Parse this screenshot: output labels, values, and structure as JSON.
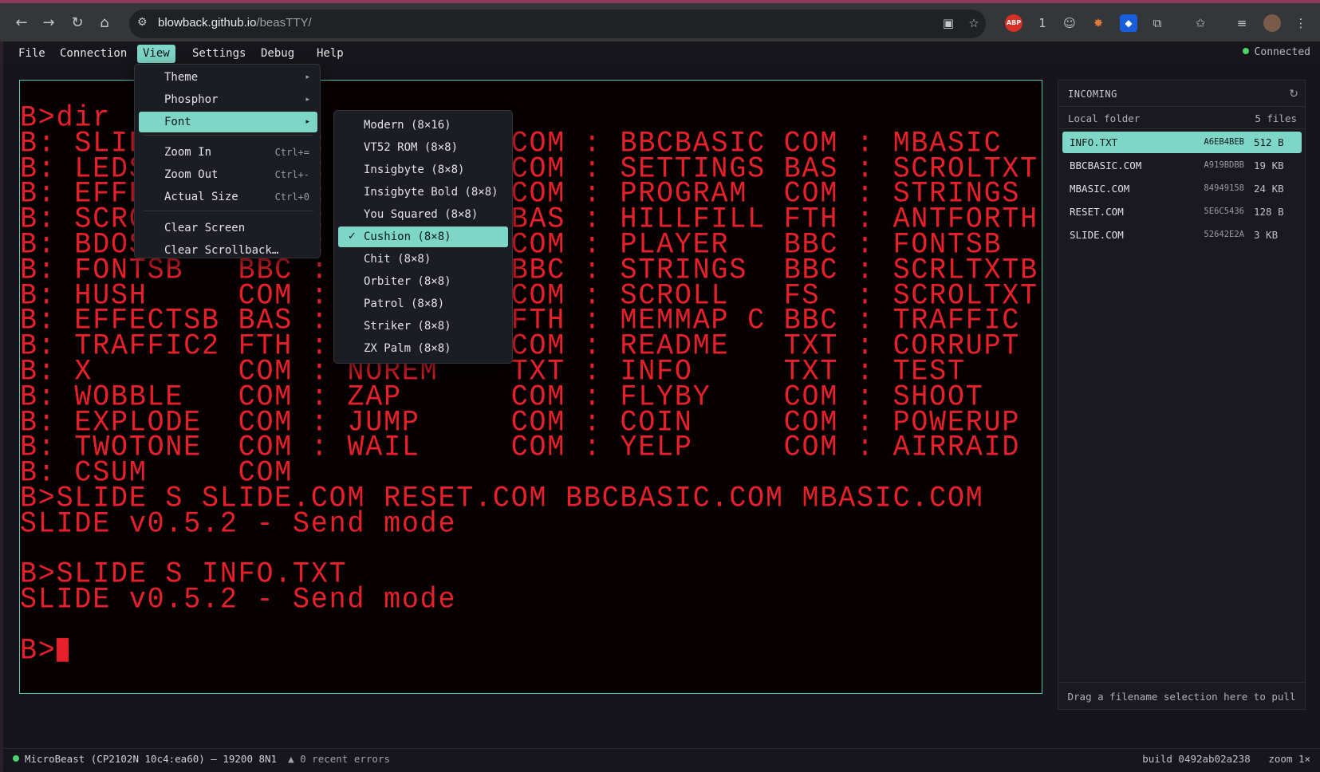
{
  "browser": {
    "url_host": "blowback.github.io",
    "url_path": "/beasTTY/",
    "abp_label": "ABP",
    "ext_badge": "1"
  },
  "app": {
    "menus": [
      "File",
      "Connection",
      "View",
      "Settings",
      "Debug",
      "Help"
    ],
    "active_menu": "View",
    "connection_status": "Connected"
  },
  "view_menu": {
    "items": [
      {
        "label": "Theme",
        "submenu": true
      },
      {
        "label": "Phosphor",
        "submenu": true
      },
      {
        "label": "Font",
        "submenu": true,
        "highlighted": true
      },
      {
        "label": "Zoom In",
        "shortcut": "Ctrl+="
      },
      {
        "label": "Zoom Out",
        "shortcut": "Ctrl+-"
      },
      {
        "label": "Actual Size",
        "shortcut": "Ctrl+0"
      },
      {
        "label": "Clear Screen"
      },
      {
        "label": "Clear Scrollback…"
      }
    ]
  },
  "font_menu": {
    "check_mark": "✓",
    "items": [
      {
        "label": "Modern (8×16)"
      },
      {
        "label": "VT52 ROM (8×8)"
      },
      {
        "label": "Insigbyte (8×8)"
      },
      {
        "label": "Insigbyte Bold (8×8)"
      },
      {
        "label": "You Squared (8×8)"
      },
      {
        "label": "Cushion (8×8)",
        "selected": true
      },
      {
        "label": "Chit (8×8)"
      },
      {
        "label": "Orbiter (8×8)"
      },
      {
        "label": "Patrol (8×8)"
      },
      {
        "label": "Striker (8×8)"
      },
      {
        "label": "ZX Palm (8×8)"
      }
    ]
  },
  "terminal": {
    "color": "#e8202a",
    "lines": [
      "B>dir",
      "B: SLIDE    COM : RESET    COM : BBCBASIC COM : MBASIC   COM",
      "B: LEDS     COM : BDOS_PL  COM : SETTINGS BAS : SCROLTXT BAS",
      "B: EFFECTS  COM : XMODEM   COM : PROGRAM  COM : STRINGS  COM",
      "B: SCROLTS  BAS : SCRNFILL BAS : HILLFILL FTH : ANTFORTH COM",
      "B: BDOS_PL  BAS : FONTS    COM : PLAYER   BBC : FONTSB   BAS",
      "B: FONTSB   BBC : STRINGS  BBC : STRINGS  BBC : SCRLTXTB BAS",
      "B: HUSH     COM : VIBE     COM : SCROLL   FS  : SCROLTXT BBC",
      "B: EFFECTSB BAS : EFFECTS  FTH : MEMMAP C BBC : TRAFFIC  FTH",
      "B: TRAFFIC2 FTH : TRAFFIC  COM : README   TXT : CORRUPT  COM",
      "B: X        COM : NOREM    TXT : INFO     TXT : TEST     COM",
      "B: WOBBLE   COM : ZAP      COM : FLYBY    COM : SHOOT    COM",
      "B: EXPLODE  COM : JUMP     COM : COIN     COM : POWERUP  COM",
      "B: TWOTONE  COM : WAIL     COM : YELP     COM : AIRRAID  COM",
      "B: CSUM     COM",
      "B>SLIDE S SLIDE.COM RESET.COM BBCBASIC.COM MBASIC.COM",
      "SLIDE v0.5.2 - Send mode",
      "",
      "B>SLIDE S INFO.TXT",
      "SLIDE v0.5.2 - Send mode",
      "",
      "B>"
    ]
  },
  "incoming": {
    "title": "INCOMING",
    "refresh_icon": "↻",
    "folder_label": "Local folder",
    "file_count": "5 files",
    "files": [
      {
        "name": "INFO.TXT",
        "hash": "A6EB4BEB",
        "size": "512 B",
        "selected": true
      },
      {
        "name": "BBCBASIC.COM",
        "hash": "A919BDBB",
        "size": "19 KB"
      },
      {
        "name": "MBASIC.COM",
        "hash": "84949158",
        "size": "24 KB"
      },
      {
        "name": "RESET.COM",
        "hash": "5E6C5436",
        "size": "128 B"
      },
      {
        "name": "SLIDE.COM",
        "hash": "52642E2A",
        "size": "3 KB"
      }
    ],
    "footer": "Drag a filename selection here to pull"
  },
  "status": {
    "device": "MicroBeast (CP2102N 10c4:ea60) — 19200 8N1",
    "errors": "▲ 0 recent errors",
    "build": "build 0492ab02a238",
    "zoom": "zoom 1×"
  }
}
